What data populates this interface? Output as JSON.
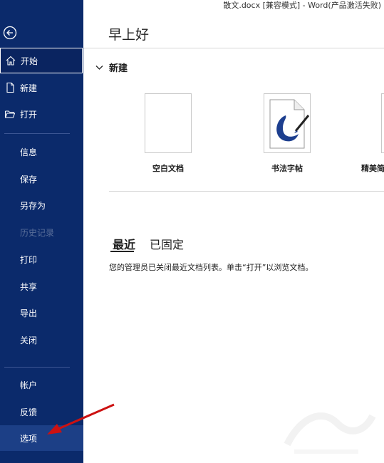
{
  "window": {
    "title": "散文.docx [兼容模式] - Word(产品激活失败)"
  },
  "sidebar": {
    "top_items": [
      {
        "label": "开始",
        "icon": "home-icon",
        "active": true
      },
      {
        "label": "新建",
        "icon": "new-doc-icon"
      },
      {
        "label": "打开",
        "icon": "open-folder-icon"
      }
    ],
    "mid_items": [
      {
        "label": "信息"
      },
      {
        "label": "保存"
      },
      {
        "label": "另存为"
      },
      {
        "label": "历史记录",
        "disabled": true
      },
      {
        "label": "打印"
      },
      {
        "label": "共享"
      },
      {
        "label": "导出"
      },
      {
        "label": "关闭"
      }
    ],
    "bottom_items": [
      {
        "label": "帐户"
      },
      {
        "label": "反馈"
      },
      {
        "label": "选项"
      }
    ],
    "colors": {
      "background": "#0b2a6b",
      "divider": "#3b5593"
    }
  },
  "main": {
    "greeting": "早上好",
    "new_section": {
      "label": "新建"
    },
    "templates": [
      {
        "label": "空白文档"
      },
      {
        "label": "书法字帖"
      },
      {
        "label": "精美简"
      }
    ],
    "tabs": [
      {
        "label": "最近",
        "active": true
      },
      {
        "label": "已固定"
      }
    ],
    "notice": "您的管理员已关闭最近文档列表。单击“打开”以浏览文档。"
  },
  "annotation": {
    "color": "#cc1111"
  }
}
